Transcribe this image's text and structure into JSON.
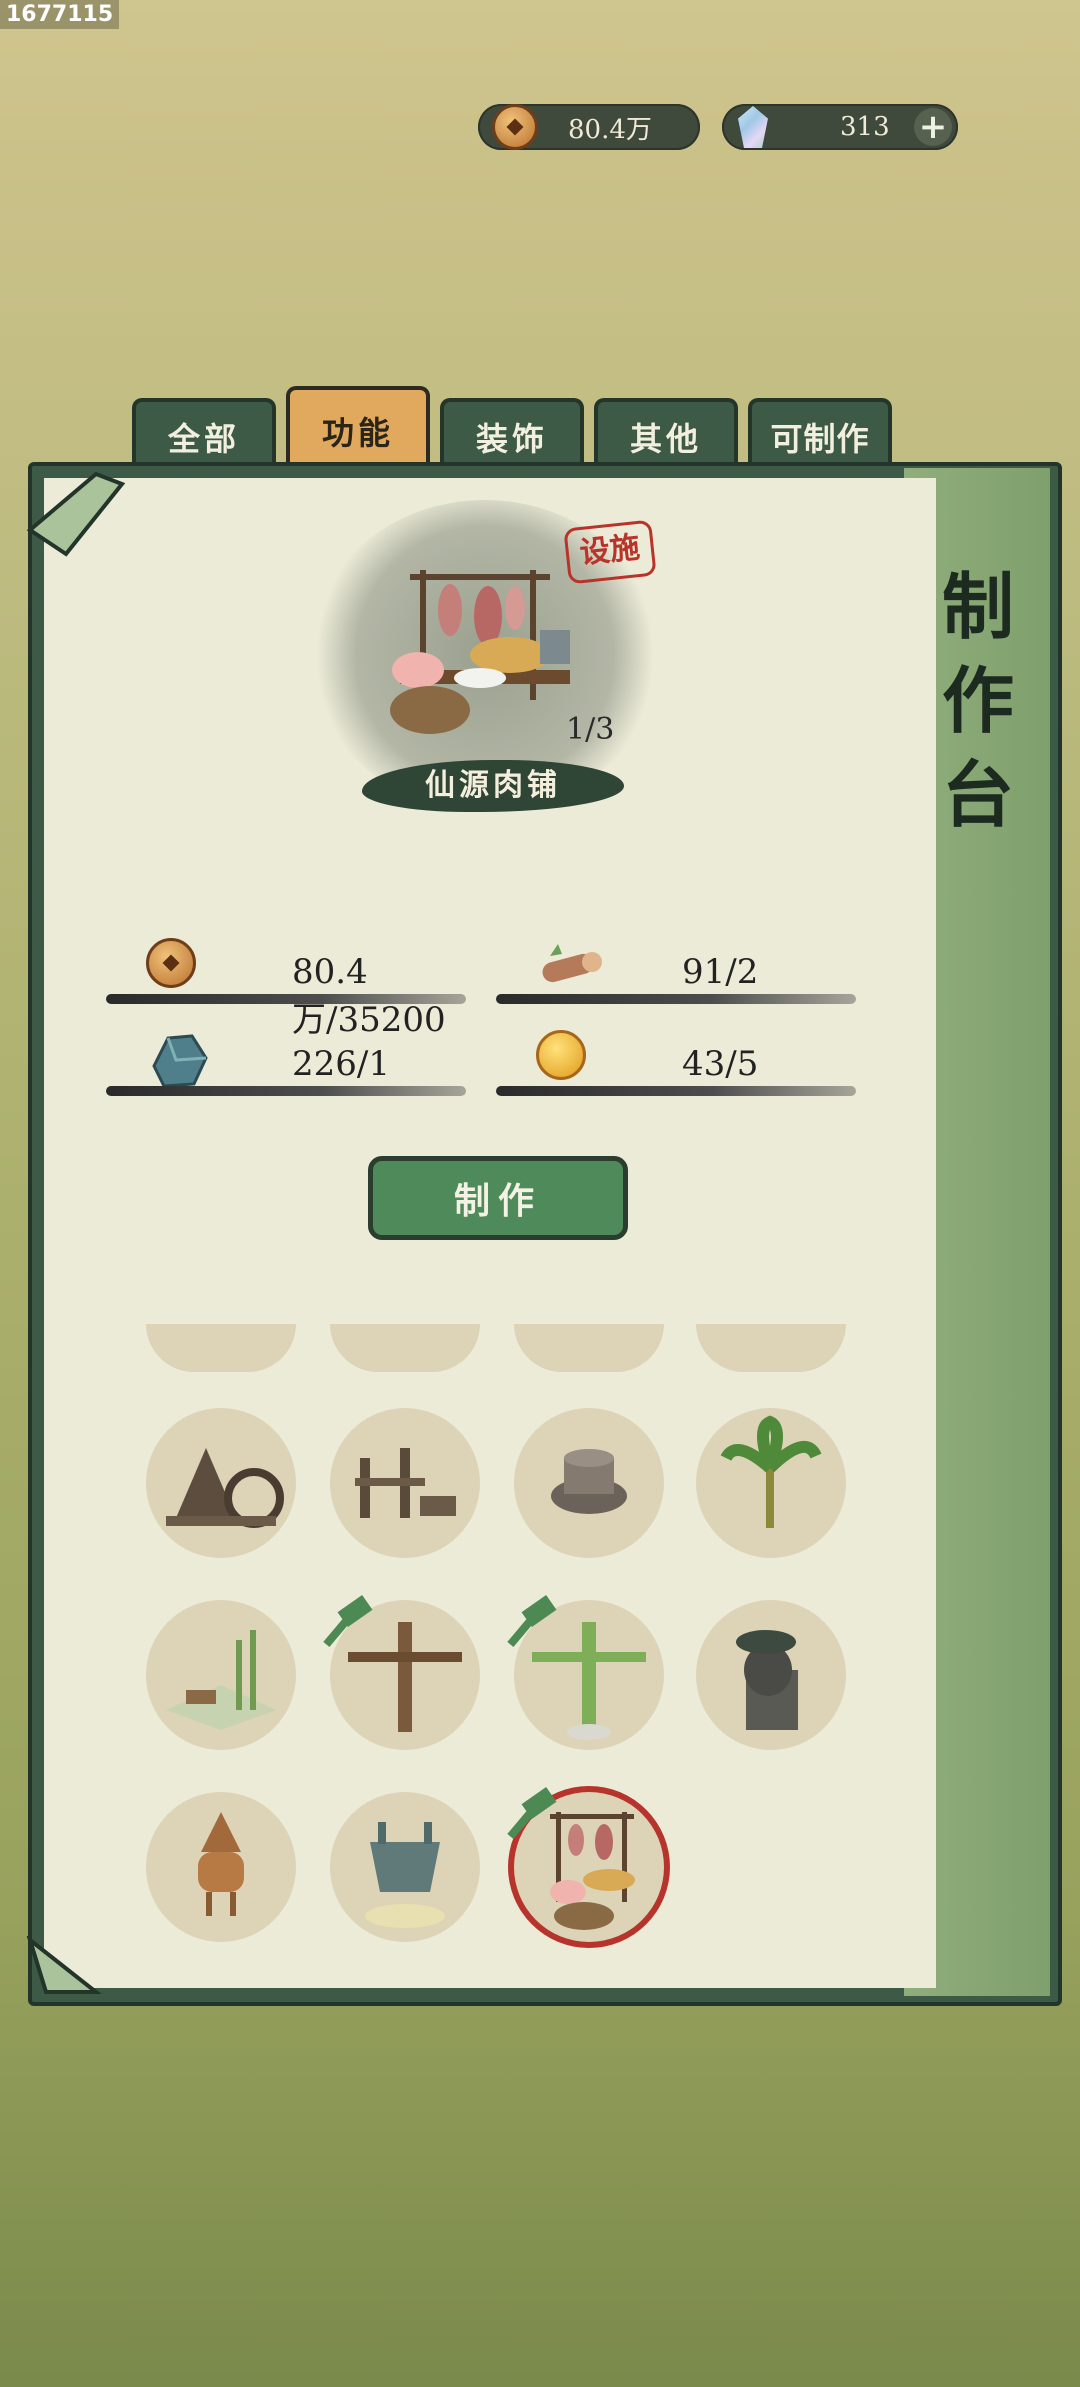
{
  "screen_id": "1677115",
  "currency": {
    "coins": "80.4万",
    "gems": "313",
    "add_label": "+"
  },
  "tabs": [
    {
      "label": "全部",
      "active": false
    },
    {
      "label": "功能",
      "active": true
    },
    {
      "label": "装饰",
      "active": false
    },
    {
      "label": "其他",
      "active": false
    },
    {
      "label": "可制作",
      "active": false
    }
  ],
  "panel": {
    "title": "制作台"
  },
  "selected": {
    "name": "仙源肉铺",
    "badge": "设施",
    "progress": "1/3"
  },
  "costs": [
    {
      "icon": "copper-coin-icon",
      "value": "80.4万/35200"
    },
    {
      "icon": "wood-log-icon",
      "value": "91/2"
    },
    {
      "icon": "blue-stone-icon",
      "value": "226/1"
    },
    {
      "icon": "gold-orb-icon",
      "value": "43/5"
    }
  ],
  "craft_button": "制作",
  "colors": {
    "tab_active": "#e0a95d",
    "tab": "#3c5a45",
    "craft_button": "#4f8a5a",
    "selected_ring": "#b6342b"
  },
  "grid_items": [
    {
      "icon": "building-icon",
      "craftable": false,
      "selected": false
    },
    {
      "icon": "building-icon",
      "craftable": false,
      "selected": false
    },
    {
      "icon": "building-icon",
      "craftable": false,
      "selected": false
    },
    {
      "icon": "building-icon",
      "craftable": false,
      "selected": false
    },
    {
      "icon": "watermill-hut-icon",
      "craftable": false,
      "selected": false
    },
    {
      "icon": "wooden-rack-icon",
      "craftable": false,
      "selected": false
    },
    {
      "icon": "stone-mill-icon",
      "craftable": false,
      "selected": false
    },
    {
      "icon": "banana-tree-icon",
      "craftable": false,
      "selected": false
    },
    {
      "icon": "bamboo-garden-icon",
      "craftable": false,
      "selected": false
    },
    {
      "icon": "wooden-post-icon",
      "craftable": true,
      "selected": false
    },
    {
      "icon": "bamboo-post-icon",
      "craftable": true,
      "selected": false
    },
    {
      "icon": "stone-stele-icon",
      "craftable": false,
      "selected": false
    },
    {
      "icon": "incense-burner-icon",
      "craftable": false,
      "selected": false
    },
    {
      "icon": "bronze-ding-icon",
      "craftable": false,
      "selected": false
    },
    {
      "icon": "butcher-stall-icon",
      "craftable": true,
      "selected": true
    }
  ]
}
